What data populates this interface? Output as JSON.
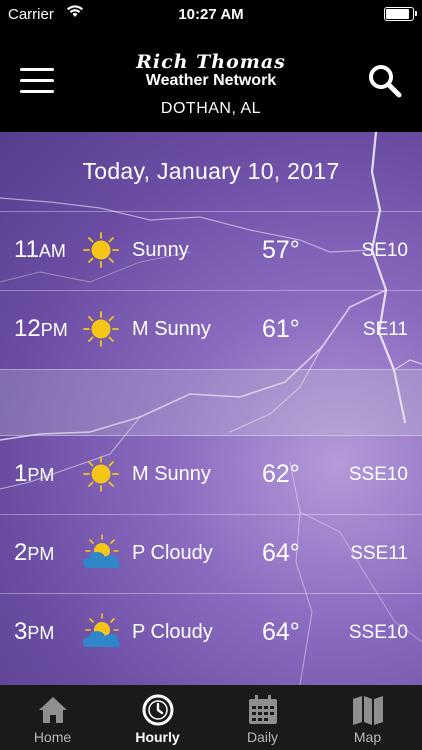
{
  "status_bar": {
    "carrier": "Carrier",
    "time": "10:27 AM",
    "battery_level": 0.95
  },
  "header": {
    "brand_script": "Rich Thomas",
    "brand_network": "Weather Network",
    "city": "DOTHAN, AL",
    "menu_icon": "hamburger-icon",
    "search_icon": "search-icon"
  },
  "main": {
    "date_title": "Today, January 10, 2017",
    "rows": [
      {
        "hour": "11",
        "ampm": "AM",
        "icon": "sun-icon",
        "condition": "Sunny",
        "temp": "57°",
        "wind": "SE10"
      },
      {
        "hour": "12",
        "ampm": "PM",
        "icon": "sun-icon",
        "condition": "M Sunny",
        "temp": "61°",
        "wind": "SE11"
      },
      {
        "hour": "1",
        "ampm": "PM",
        "icon": "sun-icon",
        "condition": "M Sunny",
        "temp": "62°",
        "wind": "SSE10"
      },
      {
        "hour": "2",
        "ampm": "PM",
        "icon": "partly-cloudy-icon",
        "condition": "P Cloudy",
        "temp": "64°",
        "wind": "SSE11"
      },
      {
        "hour": "3",
        "ampm": "PM",
        "icon": "partly-cloudy-icon",
        "condition": "P Cloudy",
        "temp": "64°",
        "wind": "SSE10"
      }
    ]
  },
  "tabbar": {
    "tabs": [
      {
        "label": "Home",
        "icon": "home-icon"
      },
      {
        "label": "Hourly",
        "icon": "clock-icon",
        "active": true
      },
      {
        "label": "Daily",
        "icon": "calendar-icon"
      },
      {
        "label": "Map",
        "icon": "map-icon"
      }
    ]
  },
  "colors": {
    "background_purple": "#7b5fb3",
    "bar": "#000000",
    "sun": "#f5c518",
    "cloud": "#2f86c9"
  }
}
